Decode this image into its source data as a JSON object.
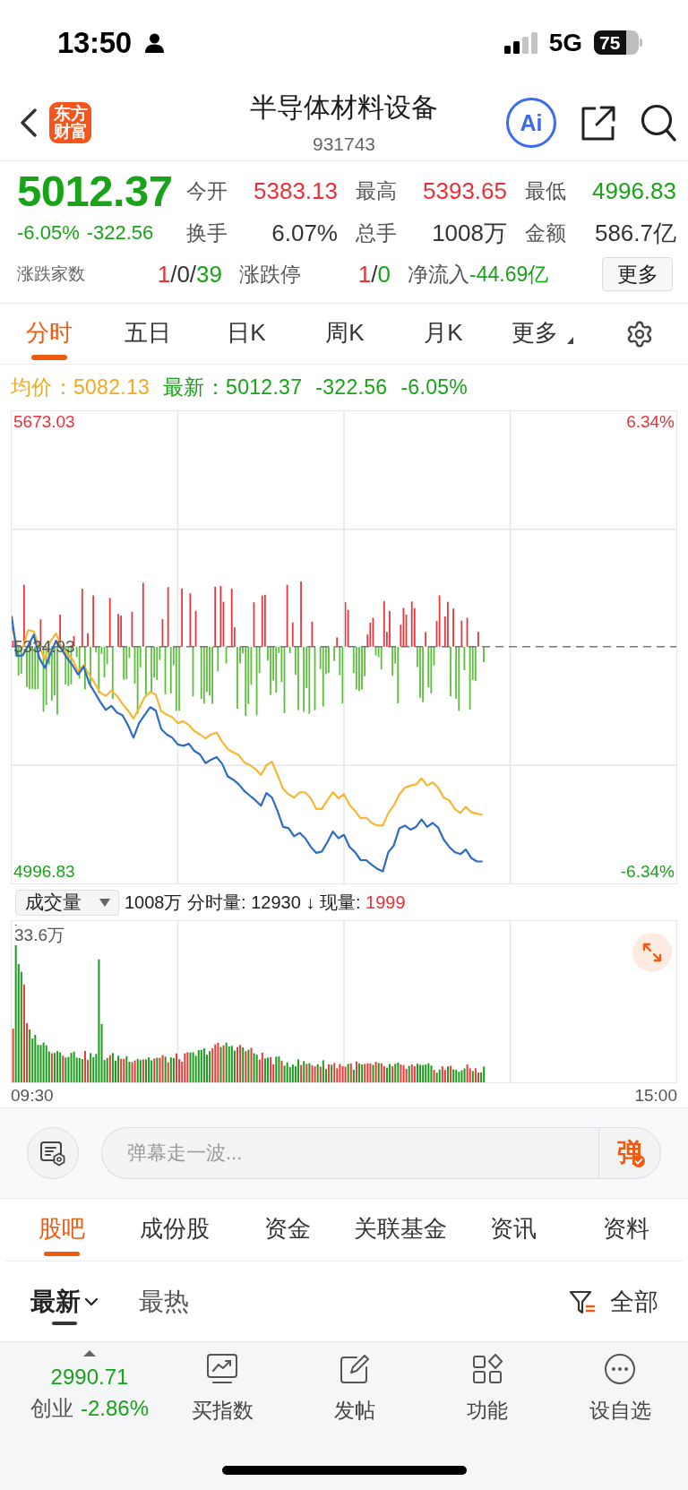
{
  "status_bar": {
    "time": "13:50",
    "network": "5G",
    "battery": "75"
  },
  "header": {
    "logo": [
      "东方",
      "财富"
    ],
    "title": "半导体材料设备",
    "code": "931743",
    "ai_button": "Ai"
  },
  "quote": {
    "price": "5012.37",
    "change_percent": "-6.05%",
    "change": "-322.56",
    "stats": [
      {
        "label": "今开",
        "value": "5383.13",
        "color": "#e8303a"
      },
      {
        "label": "最高",
        "value": "5393.65",
        "color": "#e8303a"
      },
      {
        "label": "最低",
        "value": "4996.83",
        "color": "#19a319"
      },
      {
        "label": "换手",
        "value": "6.07%",
        "color": "#333333"
      },
      {
        "label": "总手",
        "value": "1008万",
        "color": "#333333"
      },
      {
        "label": "金额",
        "value": "586.7亿",
        "color": "#333333"
      }
    ],
    "breadth": [
      {
        "kind": "caption",
        "label": "涨跌家数",
        "parts": [
          {
            "text": "1",
            "color": "#e8303a"
          },
          {
            "text": "/0/",
            "color": "#333333"
          },
          {
            "text": "39",
            "color": "#19a319"
          }
        ]
      },
      {
        "kind": "field",
        "label": "涨跌停",
        "parts": [
          {
            "text": "1",
            "color": "#e8303a"
          },
          {
            "text": "/",
            "color": "#333333"
          },
          {
            "text": "0",
            "color": "#19a319"
          }
        ]
      },
      {
        "kind": "inline",
        "label": "净流入",
        "parts": [
          {
            "text": "-44.69亿",
            "color": "#19a319"
          }
        ]
      }
    ],
    "more_button": "更多"
  },
  "chart_tabs": [
    {
      "label": "分时",
      "selected": true,
      "dropdown": false
    },
    {
      "label": "五日",
      "selected": false,
      "dropdown": false
    },
    {
      "label": "日K",
      "selected": false,
      "dropdown": false
    },
    {
      "label": "周K",
      "selected": false,
      "dropdown": false
    },
    {
      "label": "月K",
      "selected": false,
      "dropdown": false
    },
    {
      "label": "更多",
      "selected": false,
      "dropdown": true
    }
  ],
  "price_chart": {
    "separator": "：",
    "legend": [
      {
        "value": "5082.13",
        "color": "#f2a922"
      },
      {
        "value": "5012.37",
        "change": "-322.56",
        "percent": "-6.05%",
        "color": "#19a319"
      }
    ],
    "right_labels": [
      "6.34%",
      "-6.34%"
    ],
    "chart_data": {
      "type": "line",
      "grid": true,
      "ylim": [
        4979,
        5689
      ],
      "yticks": [
        {
          "value": 4996.83,
          "label": "4996.83"
        },
        {
          "value": 5673.03,
          "label": "5673.03"
        }
      ],
      "ref_lines": [
        {
          "axis": "y",
          "value": 5334.93,
          "label": "5334.93"
        }
      ],
      "categories": [
        null,
        null,
        null,
        null,
        null,
        null,
        null,
        null,
        null,
        null,
        null,
        null,
        null,
        null,
        null,
        null,
        null,
        null,
        null,
        null,
        null,
        null,
        null,
        null,
        null,
        null,
        null,
        null,
        null,
        null,
        null,
        null,
        null,
        null,
        null,
        null,
        null,
        null,
        null,
        null,
        null,
        null,
        null,
        null,
        null,
        null,
        null,
        null,
        null,
        null,
        null,
        null,
        null,
        null,
        null,
        null,
        null,
        null,
        null,
        null,
        null,
        null,
        null,
        null,
        null,
        null,
        null,
        null,
        null,
        null,
        null,
        null,
        null,
        null,
        null,
        null,
        null,
        null,
        null,
        null,
        null,
        null,
        null,
        null,
        null,
        null,
        null,
        null,
        null,
        null,
        null,
        null,
        null,
        null,
        null,
        null,
        null,
        null,
        null,
        null,
        null,
        null,
        null,
        null,
        null,
        null,
        null,
        null,
        null,
        null,
        null,
        null,
        null,
        null,
        null,
        null,
        null,
        null,
        null,
        null,
        null
      ],
      "series": [
        {
          "name": "均价",
          "color": "#f7b733",
          "values": [
            5365,
            5337,
            5334,
            5360,
            5358,
            5334,
            5316,
            5343,
            5355,
            5335,
            5324,
            5316,
            5298,
            5307,
            5293,
            5280,
            5266,
            5261,
            5269,
            5261,
            5249,
            5239,
            5227,
            5242,
            5259,
            5267,
            5263,
            5238,
            5233,
            5229,
            5220,
            5223,
            5217,
            5208,
            5203,
            5197,
            5203,
            5206,
            5192,
            5181,
            5176,
            5172,
            5161,
            5157,
            5151,
            5142,
            5157,
            5162,
            5142,
            5121,
            5113,
            5108,
            5116,
            5116,
            5107,
            5091,
            5091,
            5104,
            5116,
            5107,
            5113,
            5097,
            5088,
            5077,
            5078,
            5070,
            5066,
            5066,
            5085,
            5096,
            5113,
            5123,
            5126,
            5128,
            5137,
            5126,
            5131,
            5123,
            5108,
            5104,
            5091,
            5085,
            5094,
            5086,
            5084,
            5082,
            null,
            null,
            null,
            null,
            null,
            null,
            null,
            null,
            null,
            null,
            null,
            null,
            null,
            null,
            null,
            null,
            null,
            null,
            null,
            null,
            null,
            null,
            null,
            null,
            null,
            null,
            null,
            null,
            null,
            null,
            null,
            null,
            null,
            null,
            null
          ]
        },
        {
          "name": "最新",
          "color": "#2e6cc4",
          "values": [
            5381,
            5321,
            5322,
            5337,
            5353,
            5318,
            5303,
            5324,
            5344,
            5331,
            5318,
            5307,
            5293,
            5305,
            5280,
            5266,
            5252,
            5240,
            5246,
            5236,
            5232,
            5217,
            5198,
            5220,
            5232,
            5244,
            5239,
            5211,
            5203,
            5198,
            5188,
            5186,
            5189,
            5178,
            5173,
            5160,
            5165,
            5169,
            5159,
            5140,
            5135,
            5128,
            5118,
            5111,
            5104,
            5096,
            5115,
            5108,
            5088,
            5064,
            5062,
            5050,
            5055,
            5047,
            5034,
            5025,
            5027,
            5041,
            5057,
            5047,
            5052,
            5034,
            5026,
            5014,
            5014,
            5007,
            5001,
            4997,
            5026,
            5036,
            5062,
            5066,
            5060,
            5064,
            5075,
            5064,
            5070,
            5063,
            5045,
            5034,
            5026,
            5023,
            5030,
            5017,
            5012,
            5012,
            null,
            null,
            null,
            null,
            null,
            null,
            null,
            null,
            null,
            null,
            null,
            null,
            null,
            null,
            null,
            null,
            null,
            null,
            null,
            null,
            null,
            null,
            null,
            null,
            null,
            null,
            null,
            null,
            null,
            null,
            null,
            null,
            null,
            null,
            null
          ]
        }
      ]
    }
  },
  "volume": {
    "selector": "成交量",
    "summary": [
      {
        "text": "1008万 分时量: 12930 ↓ 现量: ",
        "color": "#222222"
      },
      {
        "text": "1999",
        "color": "#e8303a"
      }
    ],
    "max_label": "33.6万",
    "time_labels": [
      "09:30",
      "15:00"
    ]
  },
  "comment_bar": {
    "placeholder": "弹幕走一波...",
    "send_label": "弹"
  },
  "section_tabs": [
    {
      "label": "股吧",
      "selected": true
    },
    {
      "label": "成份股",
      "selected": false
    },
    {
      "label": "资金",
      "selected": false
    },
    {
      "label": "关联基金",
      "selected": false
    },
    {
      "label": "资讯",
      "selected": false
    },
    {
      "label": "资料",
      "selected": false
    }
  ],
  "sort_tabs": [
    {
      "label": "最新",
      "selected": true,
      "dropdown": true
    },
    {
      "label": "最热",
      "selected": false,
      "dropdown": false
    }
  ],
  "filter": {
    "label": "全部"
  },
  "bottom_nav": {
    "index": {
      "value": "2990.71",
      "name": "创业",
      "change": "-2.86%"
    },
    "items": [
      {
        "label": "买指数",
        "kind": "chart"
      },
      {
        "label": "发帖",
        "kind": "edit"
      },
      {
        "label": "功能",
        "kind": "grid"
      },
      {
        "label": "设自选",
        "kind": "more"
      }
    ]
  }
}
